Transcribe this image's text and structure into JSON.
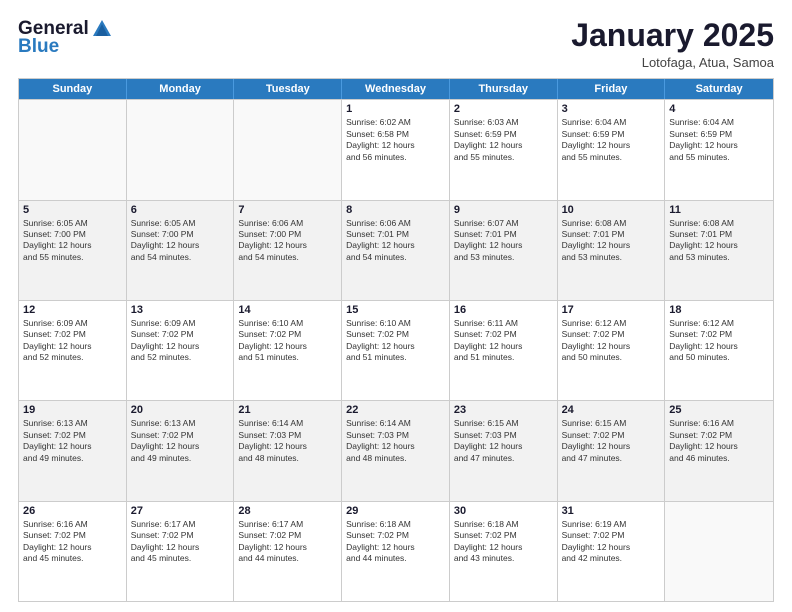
{
  "header": {
    "logo_line1": "General",
    "logo_line2": "Blue",
    "month": "January 2025",
    "location": "Lotofaga, Atua, Samoa"
  },
  "days_of_week": [
    "Sunday",
    "Monday",
    "Tuesday",
    "Wednesday",
    "Thursday",
    "Friday",
    "Saturday"
  ],
  "weeks": [
    [
      {
        "day": "",
        "info": "",
        "empty": true
      },
      {
        "day": "",
        "info": "",
        "empty": true
      },
      {
        "day": "",
        "info": "",
        "empty": true
      },
      {
        "day": "1",
        "info": "Sunrise: 6:02 AM\nSunset: 6:58 PM\nDaylight: 12 hours\nand 56 minutes.",
        "empty": false
      },
      {
        "day": "2",
        "info": "Sunrise: 6:03 AM\nSunset: 6:59 PM\nDaylight: 12 hours\nand 55 minutes.",
        "empty": false
      },
      {
        "day": "3",
        "info": "Sunrise: 6:04 AM\nSunset: 6:59 PM\nDaylight: 12 hours\nand 55 minutes.",
        "empty": false
      },
      {
        "day": "4",
        "info": "Sunrise: 6:04 AM\nSunset: 6:59 PM\nDaylight: 12 hours\nand 55 minutes.",
        "empty": false
      }
    ],
    [
      {
        "day": "5",
        "info": "Sunrise: 6:05 AM\nSunset: 7:00 PM\nDaylight: 12 hours\nand 55 minutes.",
        "empty": false
      },
      {
        "day": "6",
        "info": "Sunrise: 6:05 AM\nSunset: 7:00 PM\nDaylight: 12 hours\nand 54 minutes.",
        "empty": false
      },
      {
        "day": "7",
        "info": "Sunrise: 6:06 AM\nSunset: 7:00 PM\nDaylight: 12 hours\nand 54 minutes.",
        "empty": false
      },
      {
        "day": "8",
        "info": "Sunrise: 6:06 AM\nSunset: 7:01 PM\nDaylight: 12 hours\nand 54 minutes.",
        "empty": false
      },
      {
        "day": "9",
        "info": "Sunrise: 6:07 AM\nSunset: 7:01 PM\nDaylight: 12 hours\nand 53 minutes.",
        "empty": false
      },
      {
        "day": "10",
        "info": "Sunrise: 6:08 AM\nSunset: 7:01 PM\nDaylight: 12 hours\nand 53 minutes.",
        "empty": false
      },
      {
        "day": "11",
        "info": "Sunrise: 6:08 AM\nSunset: 7:01 PM\nDaylight: 12 hours\nand 53 minutes.",
        "empty": false
      }
    ],
    [
      {
        "day": "12",
        "info": "Sunrise: 6:09 AM\nSunset: 7:02 PM\nDaylight: 12 hours\nand 52 minutes.",
        "empty": false
      },
      {
        "day": "13",
        "info": "Sunrise: 6:09 AM\nSunset: 7:02 PM\nDaylight: 12 hours\nand 52 minutes.",
        "empty": false
      },
      {
        "day": "14",
        "info": "Sunrise: 6:10 AM\nSunset: 7:02 PM\nDaylight: 12 hours\nand 51 minutes.",
        "empty": false
      },
      {
        "day": "15",
        "info": "Sunrise: 6:10 AM\nSunset: 7:02 PM\nDaylight: 12 hours\nand 51 minutes.",
        "empty": false
      },
      {
        "day": "16",
        "info": "Sunrise: 6:11 AM\nSunset: 7:02 PM\nDaylight: 12 hours\nand 51 minutes.",
        "empty": false
      },
      {
        "day": "17",
        "info": "Sunrise: 6:12 AM\nSunset: 7:02 PM\nDaylight: 12 hours\nand 50 minutes.",
        "empty": false
      },
      {
        "day": "18",
        "info": "Sunrise: 6:12 AM\nSunset: 7:02 PM\nDaylight: 12 hours\nand 50 minutes.",
        "empty": false
      }
    ],
    [
      {
        "day": "19",
        "info": "Sunrise: 6:13 AM\nSunset: 7:02 PM\nDaylight: 12 hours\nand 49 minutes.",
        "empty": false
      },
      {
        "day": "20",
        "info": "Sunrise: 6:13 AM\nSunset: 7:02 PM\nDaylight: 12 hours\nand 49 minutes.",
        "empty": false
      },
      {
        "day": "21",
        "info": "Sunrise: 6:14 AM\nSunset: 7:03 PM\nDaylight: 12 hours\nand 48 minutes.",
        "empty": false
      },
      {
        "day": "22",
        "info": "Sunrise: 6:14 AM\nSunset: 7:03 PM\nDaylight: 12 hours\nand 48 minutes.",
        "empty": false
      },
      {
        "day": "23",
        "info": "Sunrise: 6:15 AM\nSunset: 7:03 PM\nDaylight: 12 hours\nand 47 minutes.",
        "empty": false
      },
      {
        "day": "24",
        "info": "Sunrise: 6:15 AM\nSunset: 7:02 PM\nDaylight: 12 hours\nand 47 minutes.",
        "empty": false
      },
      {
        "day": "25",
        "info": "Sunrise: 6:16 AM\nSunset: 7:02 PM\nDaylight: 12 hours\nand 46 minutes.",
        "empty": false
      }
    ],
    [
      {
        "day": "26",
        "info": "Sunrise: 6:16 AM\nSunset: 7:02 PM\nDaylight: 12 hours\nand 45 minutes.",
        "empty": false
      },
      {
        "day": "27",
        "info": "Sunrise: 6:17 AM\nSunset: 7:02 PM\nDaylight: 12 hours\nand 45 minutes.",
        "empty": false
      },
      {
        "day": "28",
        "info": "Sunrise: 6:17 AM\nSunset: 7:02 PM\nDaylight: 12 hours\nand 44 minutes.",
        "empty": false
      },
      {
        "day": "29",
        "info": "Sunrise: 6:18 AM\nSunset: 7:02 PM\nDaylight: 12 hours\nand 44 minutes.",
        "empty": false
      },
      {
        "day": "30",
        "info": "Sunrise: 6:18 AM\nSunset: 7:02 PM\nDaylight: 12 hours\nand 43 minutes.",
        "empty": false
      },
      {
        "day": "31",
        "info": "Sunrise: 6:19 AM\nSunset: 7:02 PM\nDaylight: 12 hours\nand 42 minutes.",
        "empty": false
      },
      {
        "day": "",
        "info": "",
        "empty": true
      }
    ]
  ]
}
